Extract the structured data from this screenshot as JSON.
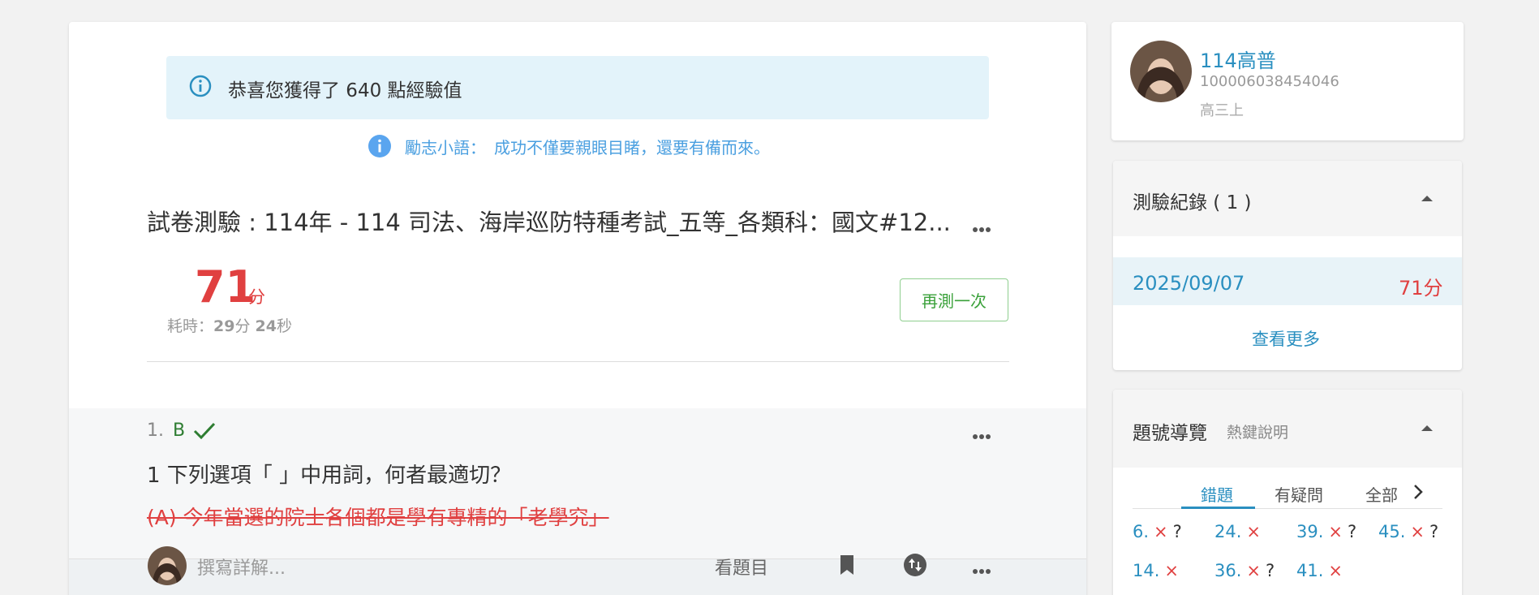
{
  "exp_banner": {
    "text": "恭喜您獲得了 640 點經驗值"
  },
  "motto": {
    "label": "勵志小語：",
    "text": "成功不僅要親眼目睹，還要有備而來。"
  },
  "paper": {
    "title": "試卷測驗 : 114年 - 114 司法、海岸巡防特種考試_五等_各類科：國文#12..."
  },
  "result": {
    "score": "71",
    "score_unit": "分",
    "elapsed_label": "耗時：",
    "elapsed_min": "29",
    "elapsed_min_unit": "分",
    "elapsed_sec": "24",
    "elapsed_sec_unit": "秒",
    "retry_label": "再測一次"
  },
  "question": {
    "number": "1.",
    "answer": "B",
    "text": "1 下列選項「 」中用詞，何者最適切？",
    "option_a": "(A) 今年當選的院士各個都是學有專精的「老學究」"
  },
  "bottom_bar": {
    "write_placeholder": "撰寫詳解...",
    "view_question": "看題目",
    "icons": [
      "bookmark-icon",
      "swap-icon",
      "more-icon"
    ]
  },
  "user": {
    "name": "114高普",
    "id": "10000603845404​6",
    "grade": "高三上"
  },
  "records": {
    "title": "測驗紀錄 ( 1 )",
    "items": [
      {
        "date": "2025/09/07",
        "score": "71分"
      }
    ],
    "more": "查看更多"
  },
  "navigator": {
    "title": "題號導覽",
    "hotkey": "熱鍵說明",
    "tabs": [
      "錯題",
      "有疑問",
      "全部"
    ],
    "items": [
      {
        "num": "6.",
        "mark": "×",
        "doubt": "?"
      },
      {
        "num": "24.",
        "mark": "×",
        "doubt": ""
      },
      {
        "num": "39.",
        "mark": "×",
        "doubt": "?"
      },
      {
        "num": "45.",
        "mark": "×",
        "doubt": "?"
      },
      {
        "num": "14.",
        "mark": "×",
        "doubt": ""
      },
      {
        "num": "36.",
        "mark": "×",
        "doubt": "?"
      },
      {
        "num": "41.",
        "mark": "×",
        "doubt": ""
      }
    ]
  },
  "colors": {
    "accent": "#2a8fc0",
    "wrong": "#e04040",
    "correct": "#2e7d32",
    "banner": "#e3f3fa"
  }
}
